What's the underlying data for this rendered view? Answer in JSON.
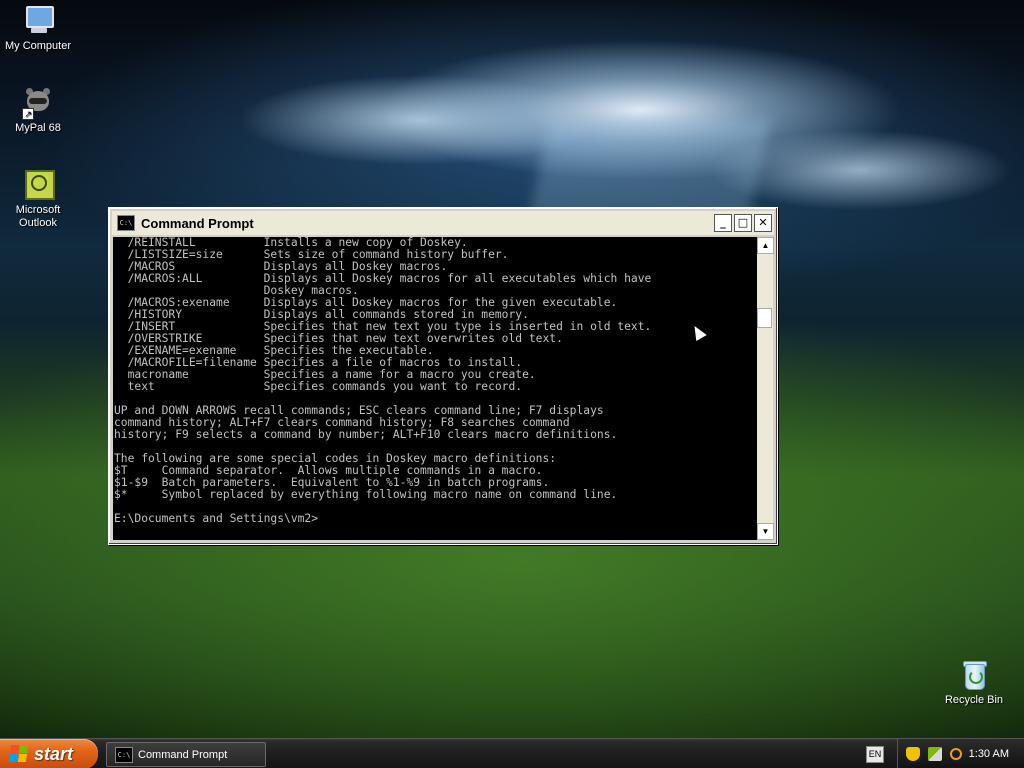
{
  "desktop": {
    "icons": [
      {
        "label": "My Computer",
        "icon": "my-computer-icon"
      },
      {
        "label": "MyPal 68",
        "icon": "mypal-raccoon-icon"
      },
      {
        "label": "Microsoft Outlook",
        "icon": "outlook-icon"
      },
      {
        "label": "Recycle Bin",
        "icon": "recycle-bin-icon"
      }
    ]
  },
  "window": {
    "title": "Command Prompt",
    "icon_text": "C:\\",
    "buttons": {
      "minimize": "_",
      "maximize": "□",
      "close": "✕"
    },
    "console_lines": [
      "  /REINSTALL          Installs a new copy of Doskey.",
      "  /LISTSIZE=size      Sets size of command history buffer.",
      "  /MACROS             Displays all Doskey macros.",
      "  /MACROS:ALL         Displays all Doskey macros for all executables which have",
      "                      Doskey macros.",
      "  /MACROS:exename     Displays all Doskey macros for the given executable.",
      "  /HISTORY            Displays all commands stored in memory.",
      "  /INSERT             Specifies that new text you type is inserted in old text.",
      "  /OVERSTRIKE         Specifies that new text overwrites old text.",
      "  /EXENAME=exename    Specifies the executable.",
      "  /MACROFILE=filename Specifies a file of macros to install.",
      "  macroname           Specifies a name for a macro you create.",
      "  text                Specifies commands you want to record.",
      "",
      "UP and DOWN ARROWS recall commands; ESC clears command line; F7 displays",
      "command history; ALT+F7 clears command history; F8 searches command",
      "history; F9 selects a command by number; ALT+F10 clears macro definitions.",
      "",
      "The following are some special codes in Doskey macro definitions:",
      "$T     Command separator.  Allows multiple commands in a macro.",
      "$1-$9  Batch parameters.  Equivalent to %1-%9 in batch programs.",
      "$*     Symbol replaced by everything following macro name on command line.",
      "",
      "E:\\Documents and Settings\\vm2>"
    ]
  },
  "taskbar": {
    "start_label": "start",
    "task_buttons": [
      {
        "label": "Command Prompt"
      }
    ],
    "language": "EN",
    "clock": "1:30 AM"
  }
}
